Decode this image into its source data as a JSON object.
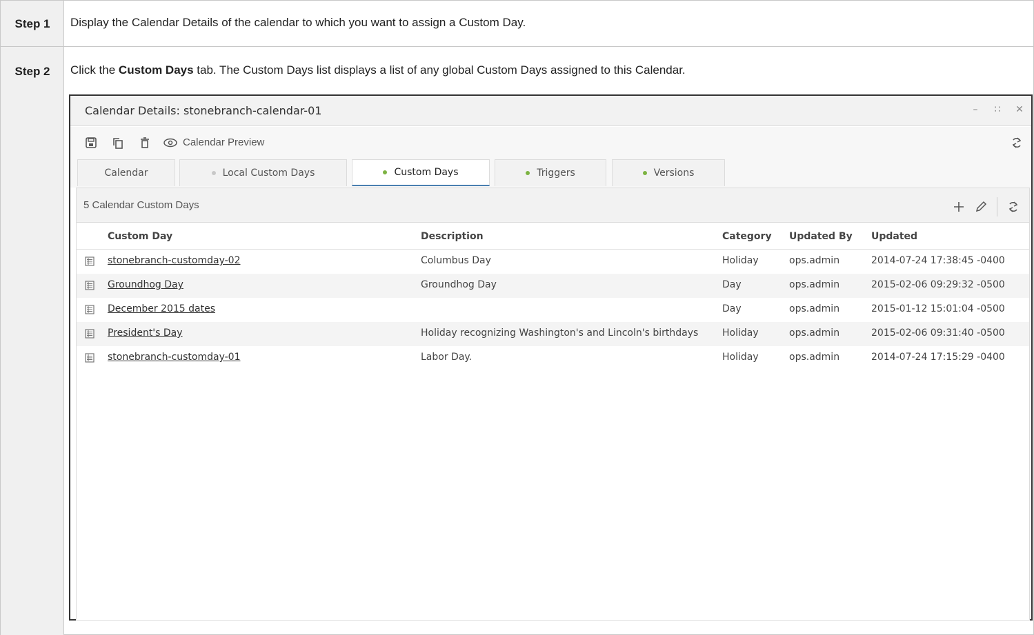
{
  "steps": [
    {
      "label": "Step 1",
      "text": "Display the Calendar Details of the calendar to which you want to assign a Custom Day."
    },
    {
      "label": "Step 2",
      "text_prefix": "Click the ",
      "text_bold": "Custom Days",
      "text_suffix": " tab. The Custom Days list displays a list of any global Custom Days assigned to this Calendar."
    }
  ],
  "window": {
    "title": "Calendar Details: stonebranch-calendar-01",
    "controls": [
      "minimize-icon",
      "maximize-icon",
      "close-icon"
    ]
  },
  "toolbar": {
    "icons": [
      "save-icon",
      "copy-icon",
      "delete-icon",
      "eye-icon",
      "refresh-icon"
    ],
    "preview_label": "Calendar Preview"
  },
  "tabs": [
    {
      "label": "Calendar",
      "dot": null,
      "active": false
    },
    {
      "label": "Local Custom Days",
      "dot": "#c8c8c8",
      "active": false
    },
    {
      "label": "Custom Days",
      "dot": "#7cb342",
      "active": true
    },
    {
      "label": "Triggers",
      "dot": "#7cb342",
      "active": false
    },
    {
      "label": "Versions",
      "dot": "#7cb342",
      "active": false
    }
  ],
  "grid": {
    "count_label": "5 Calendar Custom Days",
    "actions": [
      "add-icon",
      "edit-icon",
      "refresh-icon"
    ],
    "columns": [
      "Custom Day",
      "Description",
      "Category",
      "Updated By",
      "Updated"
    ],
    "rows": [
      {
        "name": "stonebranch-customday-02",
        "description": "Columbus Day",
        "category": "Holiday",
        "updated_by": "ops.admin",
        "updated": "2014-07-24 17:38:45 -0400"
      },
      {
        "name": "Groundhog Day",
        "description": "Groundhog Day",
        "category": "Day",
        "updated_by": "ops.admin",
        "updated": "2015-02-06 09:29:32 -0500"
      },
      {
        "name": "December 2015 dates",
        "description": "",
        "category": "Day",
        "updated_by": "ops.admin",
        "updated": "2015-01-12 15:01:04 -0500"
      },
      {
        "name": "President's Day",
        "description": "Holiday recognizing Washington's and Lincoln's birthdays",
        "category": "Holiday",
        "updated_by": "ops.admin",
        "updated": "2015-02-06 09:31:40 -0500"
      },
      {
        "name": "stonebranch-customday-01",
        "description": "Labor Day.",
        "category": "Holiday",
        "updated_by": "ops.admin",
        "updated": "2014-07-24 17:15:29 -0400"
      }
    ]
  },
  "colors": {
    "active_tab_underline": "#4a7fb0",
    "dot_green": "#7cb342",
    "dot_grey": "#c8c8c8"
  }
}
